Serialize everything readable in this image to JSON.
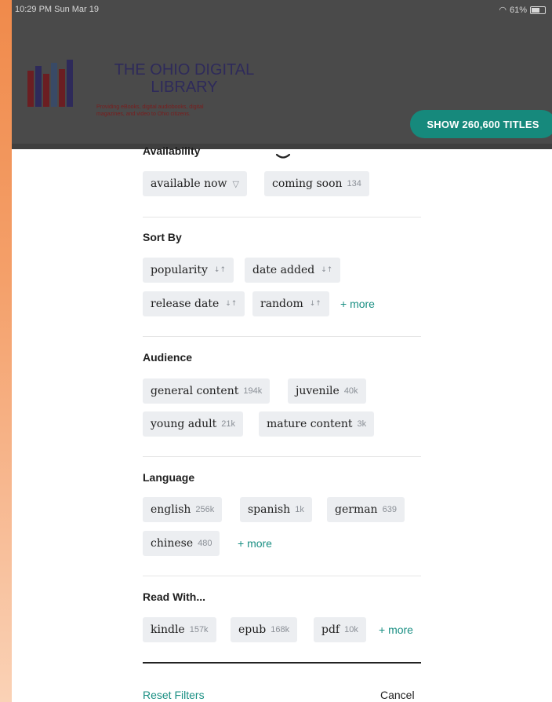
{
  "status": {
    "time": "10:29 PM  Sun Mar 19",
    "battery": "61%"
  },
  "library": {
    "title_line1": "THE OHIO DIGITAL",
    "title_line2": "LIBRARY",
    "tagline_line1": "Providing eBooks, digital audiobooks, digital",
    "tagline_line2": "magazines, and video to Ohio citizens."
  },
  "show_button": "SHOW 260,600 TITLES",
  "sections": {
    "availability": {
      "title": "Availability",
      "chips": [
        {
          "label": "available now",
          "count": ""
        },
        {
          "label": "coming soon",
          "count": "134"
        }
      ]
    },
    "sort": {
      "title": "Sort By",
      "chips": [
        {
          "label": "popularity"
        },
        {
          "label": "date added"
        },
        {
          "label": "release date"
        },
        {
          "label": "random"
        }
      ],
      "more": "+ more"
    },
    "audience": {
      "title": "Audience",
      "chips": [
        {
          "label": "general content",
          "count": "194k"
        },
        {
          "label": "juvenile",
          "count": "40k"
        },
        {
          "label": "young adult",
          "count": "21k"
        },
        {
          "label": "mature content",
          "count": "3k"
        }
      ]
    },
    "language": {
      "title": "Language",
      "chips": [
        {
          "label": "english",
          "count": "256k"
        },
        {
          "label": "spanish",
          "count": "1k"
        },
        {
          "label": "german",
          "count": "639"
        },
        {
          "label": "chinese",
          "count": "480"
        }
      ],
      "more": "+ more"
    },
    "read_with": {
      "title": "Read With...",
      "chips": [
        {
          "label": "kindle",
          "count": "157k"
        },
        {
          "label": "epub",
          "count": "168k"
        },
        {
          "label": "pdf",
          "count": "10k"
        }
      ],
      "more": "+ more"
    }
  },
  "footer": {
    "reset": "Reset Filters",
    "cancel": "Cancel"
  },
  "colors": {
    "accent": "#16897c",
    "chip_bg": "#eceef1",
    "header_dim": "#4a4a4a",
    "page_bg": "#f08a4b"
  }
}
